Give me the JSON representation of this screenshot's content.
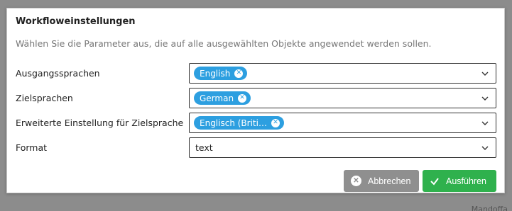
{
  "dialog": {
    "title": "Workfloweinstellungen",
    "subtitle": "Wählen Sie die Parameter aus, die auf alle ausgewählten Objekte angewendet werden sollen."
  },
  "fields": [
    {
      "label": "Ausgangssprachen",
      "chip": "English"
    },
    {
      "label": "Zielsprachen",
      "chip": "German"
    },
    {
      "label": "Erweiterte Einstellung für Zielsprache",
      "chip": "Englisch (Briti…"
    },
    {
      "label": "Format",
      "value": "text"
    }
  ],
  "buttons": {
    "cancel": "Abbrechen",
    "run": "Ausführen"
  },
  "background_text": "Mandoffa",
  "colors": {
    "chip": "#2d9fe0",
    "run_button": "#2fb14d",
    "cancel_button": "#8f8f8f"
  }
}
